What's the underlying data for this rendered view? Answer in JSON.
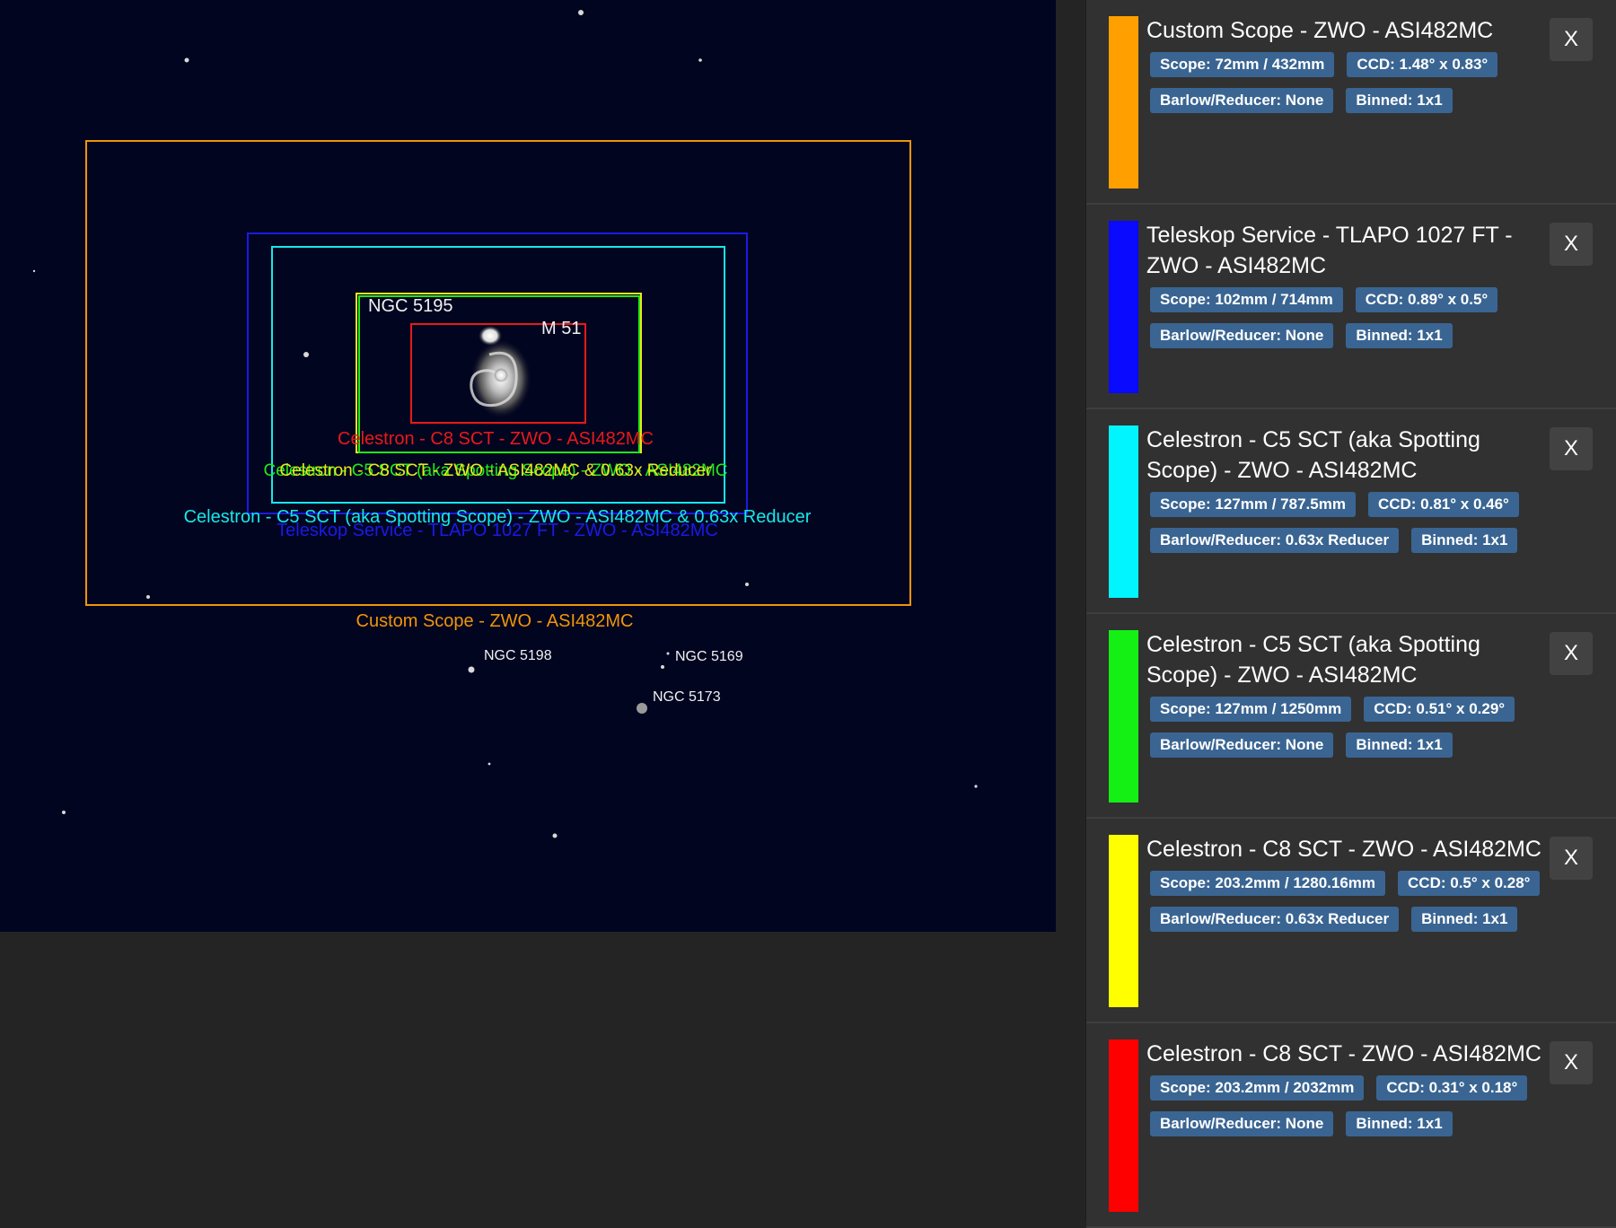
{
  "sky": {
    "objects": {
      "ngc5195": "NGC 5195",
      "m51": "M 51",
      "ngc5198": "NGC 5198",
      "ngc5169": "NGC 5169",
      "ngc5173": "NGC 5173"
    },
    "fov_labels": {
      "custom": "Custom Scope - ZWO - ASI482MC",
      "teleskop": "Teleskop Service - TLAPO 1027 FT - ZWO - ASI482MC",
      "c5_reducer": "Celestron - C5 SCT (aka Spotting Scope) - ZWO - ASI482MC  & 0.63x Reducer",
      "c5": "Celestron - C5 SCT (aka Spotting Scope) - ZWO - ASI482MC",
      "c8_reducer": "Celestron - C8 SCT - ZWO - ASI482MC  & 0.63x Reducer",
      "c8": "Celestron - C8 SCT - ZWO - ASI482MC"
    },
    "colors": {
      "custom": "#f0950a",
      "teleskop": "#1a1ae8",
      "c5_reducer": "#18e8e8",
      "c5": "#22e81a",
      "c8_reducer": "#e8e81a",
      "c8": "#e81a1a"
    }
  },
  "panel": {
    "close_label": "X",
    "cards": [
      {
        "color": "#ff9f00",
        "title": "Custom Scope - ZWO - ASI482MC",
        "scope": "Scope: 72mm / 432mm",
        "ccd": "CCD: 1.48° x 0.83°",
        "barlow": "Barlow/Reducer: None",
        "binned": "Binned: 1x1"
      },
      {
        "color": "#0a0aff",
        "title": "Teleskop Service - TLAPO 1027 FT - ZWO - ASI482MC",
        "scope": "Scope: 102mm / 714mm",
        "ccd": "CCD: 0.89° x 0.5°",
        "barlow": "Barlow/Reducer: None",
        "binned": "Binned: 1x1"
      },
      {
        "color": "#00f5ff",
        "title": "Celestron - C5 SCT (aka Spotting Scope) - ZWO - ASI482MC",
        "scope": "Scope: 127mm / 787.5mm",
        "ccd": "CCD: 0.81° x 0.46°",
        "barlow": "Barlow/Reducer: 0.63x Reducer",
        "binned": "Binned: 1x1"
      },
      {
        "color": "#14f014",
        "title": "Celestron - C5 SCT (aka Spotting Scope) - ZWO - ASI482MC",
        "scope": "Scope: 127mm / 1250mm",
        "ccd": "CCD: 0.51° x 0.29°",
        "barlow": "Barlow/Reducer: None",
        "binned": "Binned: 1x1"
      },
      {
        "color": "#ffff00",
        "title": "Celestron - C8 SCT - ZWO - ASI482MC",
        "scope": "Scope: 203.2mm / 1280.16mm",
        "ccd": "CCD: 0.5° x 0.28°",
        "barlow": "Barlow/Reducer: 0.63x Reducer",
        "binned": "Binned: 1x1"
      },
      {
        "color": "#ff0000",
        "title": "Celestron - C8 SCT - ZWO - ASI482MC",
        "scope": "Scope: 203.2mm / 2032mm",
        "ccd": "CCD: 0.31° x 0.18°",
        "barlow": "Barlow/Reducer: None",
        "binned": "Binned: 1x1"
      }
    ]
  }
}
